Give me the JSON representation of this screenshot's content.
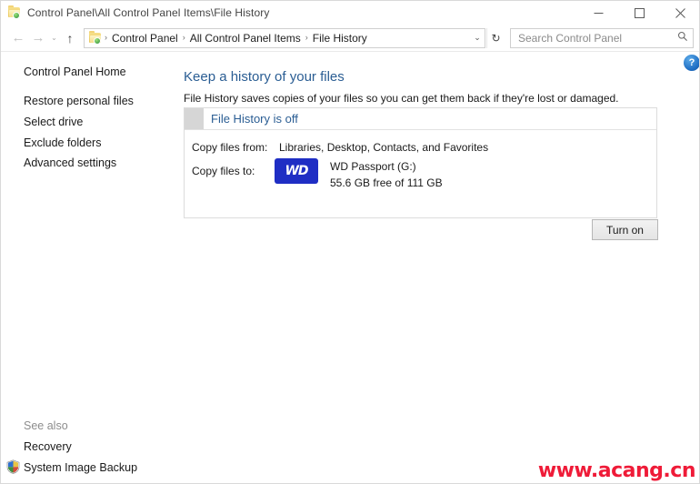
{
  "window": {
    "title": "Control Panel\\All Control Panel Items\\File History",
    "icon": "folder-icon",
    "minimize_label": "Minimize",
    "maximize_label": "Maximize",
    "close_label": "Close"
  },
  "navbar": {
    "back_label": "←",
    "forward_label": "→",
    "recent_chevron": "⌄",
    "up_label": "↑",
    "breadcrumbs": [
      {
        "label": "Control Panel"
      },
      {
        "label": "All Control Panel Items"
      },
      {
        "label": "File History"
      }
    ],
    "separator": "›",
    "dropdown_chevron": "⌄",
    "refresh_label": "↻",
    "search": {
      "placeholder": "Search Control Panel",
      "value": "",
      "icon": "search-icon"
    }
  },
  "sidebar": {
    "home_label": "Control Panel Home",
    "items": [
      {
        "label": "Restore personal files"
      },
      {
        "label": "Select drive"
      },
      {
        "label": "Exclude folders"
      },
      {
        "label": "Advanced settings"
      }
    ],
    "see_also_label": "See also",
    "see_also_items": [
      {
        "label": "Recovery",
        "icon": ""
      },
      {
        "label": "System Image Backup",
        "icon": "shield-icon"
      }
    ]
  },
  "content": {
    "title": "Keep a history of your files",
    "subtitle": "File History saves copies of your files so you can get them back if they're lost or damaged.",
    "status": {
      "text": "File History is off",
      "state": "off"
    },
    "details": [
      {
        "label": "Copy files from:",
        "value": "Libraries, Desktop, Contacts, and Favorites"
      },
      {
        "label": "Copy files to:",
        "drive_icon_text": "WD",
        "drive_name": "WD Passport (G:)",
        "drive_capacity": "55.6 GB free of 111 GB"
      }
    ],
    "turn_on_label": "Turn on",
    "help_label": "?"
  },
  "watermark": {
    "text": "www.acang.cn"
  },
  "colors": {
    "accent_blue": "#2a5d93",
    "wd_blue": "#1f2ec4",
    "watermark_red": "#ef1b38",
    "window_bg": "#ffffff"
  }
}
